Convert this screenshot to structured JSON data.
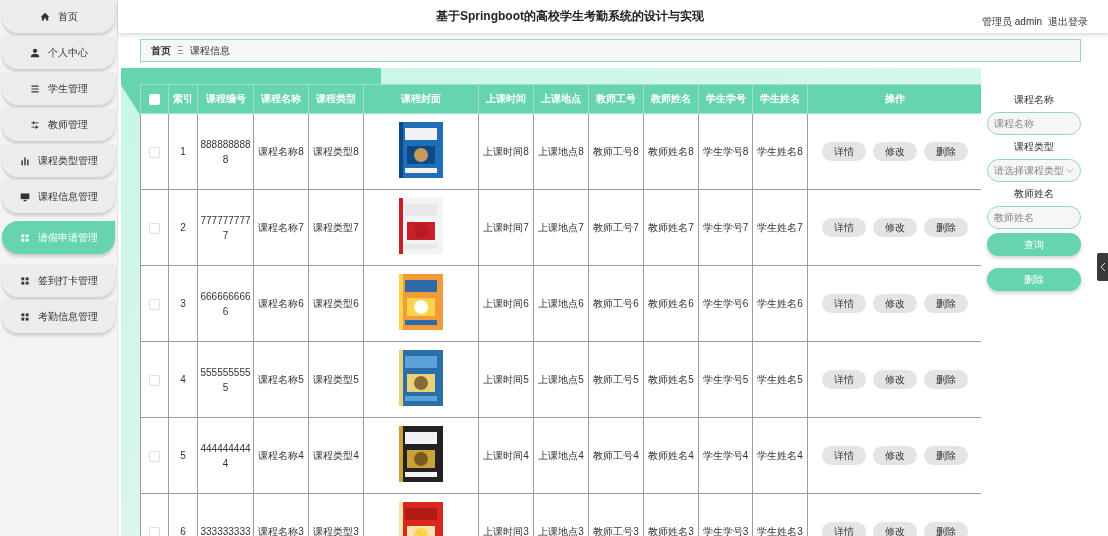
{
  "header": {
    "title": "基于Springboot的高校学生考勤系统的设计与实现",
    "role": "管理员",
    "user": "admin",
    "logout": "退出登录"
  },
  "sidebar": {
    "items": [
      {
        "label": "首页",
        "selected": false
      },
      {
        "label": "个人中心",
        "selected": false
      },
      {
        "label": "学生管理",
        "selected": false
      },
      {
        "label": "教师管理",
        "selected": false
      },
      {
        "label": "课程类型管理",
        "selected": false
      },
      {
        "label": "课程信息管理",
        "selected": false
      },
      {
        "label": "请假申请管理",
        "selected": true
      },
      {
        "label": "签到打卡管理",
        "selected": false
      },
      {
        "label": "考勤信息管理",
        "selected": false
      }
    ]
  },
  "breadcrumb": {
    "home": "首页",
    "separator": "Ξ",
    "current": "课程信息"
  },
  "table": {
    "select_all": {
      "checked": false
    },
    "columns": [
      "索引",
      "课程编号",
      "课程名称",
      "课程类型",
      "课程封面",
      "上课时间",
      "上课地点",
      "教师工号",
      "教师姓名",
      "学生学号",
      "学生姓名",
      "操作"
    ],
    "rows": [
      {
        "checked": false,
        "index": "1",
        "code": "8888888888",
        "name": "课程名称8",
        "type": "课程类型8",
        "time": "上课时间8",
        "place": "上课地点8",
        "teacher_id": "教师工号8",
        "teacher_name": "教师姓名8",
        "student_id": "学生学号8",
        "student_name": "学生姓名8",
        "actions": [
          "详情",
          "修改",
          "删除"
        ]
      },
      {
        "checked": false,
        "index": "2",
        "code": "7777777777",
        "name": "课程名称7",
        "type": "课程类型7",
        "time": "上课时间7",
        "place": "上课地点7",
        "teacher_id": "教师工号7",
        "teacher_name": "教师姓名7",
        "student_id": "学生学号7",
        "student_name": "学生姓名7",
        "actions": [
          "详情",
          "修改",
          "删除"
        ]
      },
      {
        "checked": false,
        "index": "3",
        "code": "6666666666",
        "name": "课程名称6",
        "type": "课程类型6",
        "time": "上课时间6",
        "place": "上课地点6",
        "teacher_id": "教师工号6",
        "teacher_name": "教师姓名6",
        "student_id": "学生学号6",
        "student_name": "学生姓名6",
        "actions": [
          "详情",
          "修改",
          "删除"
        ]
      },
      {
        "checked": false,
        "index": "4",
        "code": "5555555555",
        "name": "课程名称5",
        "type": "课程类型5",
        "time": "上课时间5",
        "place": "上课地点5",
        "teacher_id": "教师工号5",
        "teacher_name": "教师姓名5",
        "student_id": "学生学号5",
        "student_name": "学生姓名5",
        "actions": [
          "详情",
          "修改",
          "删除"
        ]
      },
      {
        "checked": false,
        "index": "5",
        "code": "4444444444",
        "name": "课程名称4",
        "type": "课程类型4",
        "time": "上课时间4",
        "place": "上课地点4",
        "teacher_id": "教师工号4",
        "teacher_name": "教师姓名4",
        "student_id": "学生学号4",
        "student_name": "学生姓名4",
        "actions": [
          "详情",
          "修改",
          "删除"
        ]
      },
      {
        "checked": false,
        "index": "6",
        "code": "333333333",
        "name": "课程名称3",
        "type": "课程类型3",
        "time": "上课时间3",
        "place": "上课地点3",
        "teacher_id": "教师工号3",
        "teacher_name": "教师姓名3",
        "student_id": "学生学号3",
        "student_name": "学生姓名3",
        "actions": [
          "详情",
          "修改",
          "删除"
        ]
      }
    ]
  },
  "search": {
    "fields": [
      {
        "label": "课程名称",
        "kind": "input",
        "placeholder": "课程名称"
      },
      {
        "label": "课程类型",
        "kind": "select",
        "placeholder": "请选择课程类型"
      },
      {
        "label": "教师姓名",
        "kind": "input",
        "placeholder": "教师姓名"
      }
    ],
    "buttons": [
      "查询",
      "删除"
    ]
  }
}
